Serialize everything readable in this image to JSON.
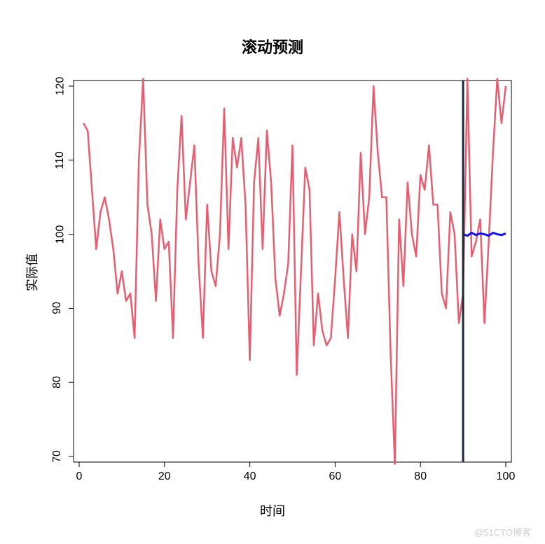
{
  "chart_data": {
    "type": "line",
    "title": "滚动预测",
    "xlabel": "时间",
    "ylabel": "实际值",
    "xlim": [
      0,
      100
    ],
    "ylim": [
      70,
      120
    ],
    "xticks": [
      0,
      20,
      40,
      60,
      80,
      100
    ],
    "yticks": [
      70,
      80,
      90,
      100,
      110,
      120
    ],
    "vline_x": 90,
    "series": [
      {
        "name": "actual",
        "color": "#e85d6f",
        "x": [
          1,
          2,
          3,
          4,
          5,
          6,
          7,
          8,
          9,
          10,
          11,
          12,
          13,
          14,
          15,
          16,
          17,
          18,
          19,
          20,
          21,
          22,
          23,
          24,
          25,
          26,
          27,
          28,
          29,
          30,
          31,
          32,
          33,
          34,
          35,
          36,
          37,
          38,
          39,
          40,
          41,
          42,
          43,
          44,
          45,
          46,
          47,
          48,
          49,
          50,
          51,
          52,
          53,
          54,
          55,
          56,
          57,
          58,
          59,
          60,
          61,
          62,
          63,
          64,
          65,
          66,
          67,
          68,
          69,
          70,
          71,
          72,
          73,
          74,
          75,
          76,
          77,
          78,
          79,
          80,
          81,
          82,
          83,
          84,
          85,
          86,
          87,
          88,
          89,
          90,
          91,
          92,
          93,
          94,
          95,
          96,
          97,
          98,
          99,
          100
        ],
        "y": [
          115,
          114,
          106,
          98,
          103,
          105,
          102,
          98,
          92,
          95,
          91,
          92,
          86,
          110,
          121,
          104,
          100,
          91,
          102,
          98,
          99,
          86,
          106,
          116,
          102,
          107,
          112,
          96,
          86,
          104,
          95,
          93,
          100,
          117,
          98,
          113,
          109,
          113,
          104,
          83,
          107,
          113,
          98,
          114,
          107,
          94,
          89,
          92,
          96,
          112,
          81,
          95,
          109,
          106,
          85,
          92,
          87,
          85,
          86,
          94,
          103,
          94,
          86,
          100,
          95,
          111,
          100,
          105,
          120,
          111,
          105,
          105,
          84,
          69,
          102,
          93,
          107,
          100,
          97,
          108,
          106,
          112,
          104,
          104,
          92,
          90,
          103,
          100,
          88,
          92,
          121,
          97,
          99,
          102,
          88,
          99,
          111,
          121,
          115,
          120
        ]
      },
      {
        "name": "forecast",
        "color": "#1010ff",
        "x": [
          90,
          91,
          92,
          93,
          94,
          95,
          96,
          97,
          98,
          99,
          100
        ],
        "y": [
          100,
          99.8,
          100.2,
          99.9,
          100.1,
          100,
          99.8,
          100.2,
          100,
          99.9,
          100.1
        ]
      }
    ]
  },
  "watermark": "@51CTO博客"
}
